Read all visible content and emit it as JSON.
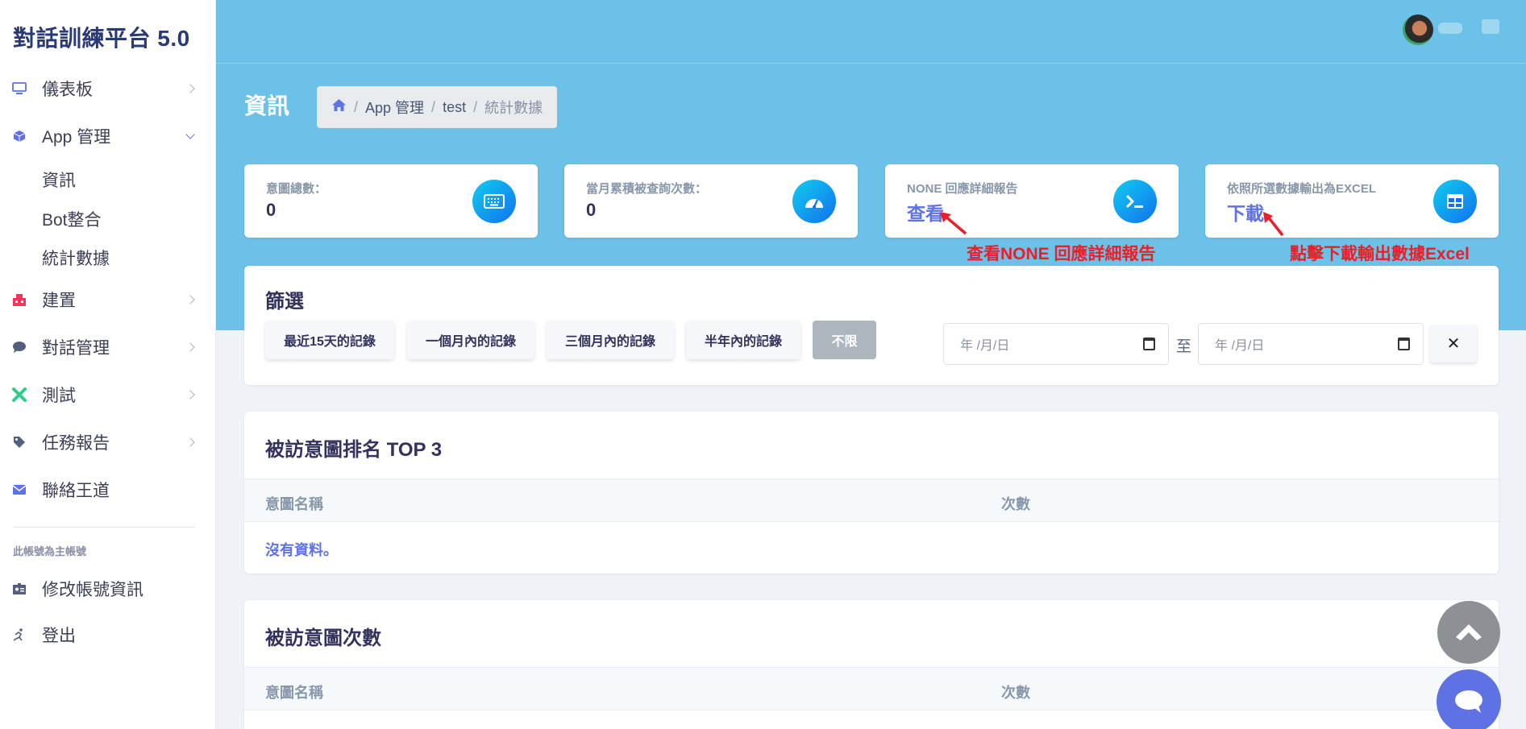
{
  "sidebar": {
    "brand": "對話訓練平台 5.0",
    "items": [
      {
        "label": "儀表板",
        "icon": "monitor-icon"
      },
      {
        "label": "App 管理",
        "icon": "cube-icon"
      },
      {
        "label": "建置",
        "icon": "build-icon"
      },
      {
        "label": "對話管理",
        "icon": "chat-bubble-icon"
      },
      {
        "label": "測試",
        "icon": "tools-icon"
      },
      {
        "label": "任務報告",
        "icon": "tag-icon"
      },
      {
        "label": "聯絡王道",
        "icon": "envelope-icon"
      }
    ],
    "sub_items": [
      "資訊",
      "Bot整合",
      "統計數據"
    ],
    "account_note": "此帳號為主帳號",
    "account_items": [
      {
        "label": "修改帳號資訊",
        "icon": "id-badge-icon"
      },
      {
        "label": "登出",
        "icon": "running-icon"
      }
    ]
  },
  "header": {
    "page_title": "資訊",
    "breadcrumb": [
      "App 管理",
      "test",
      "統計數據"
    ]
  },
  "stats": [
    {
      "title": "意圖總數：",
      "value": "0",
      "icon": "keyboard-icon"
    },
    {
      "title": "當月累積被查詢次數：",
      "value": "0",
      "icon": "speedometer-icon"
    },
    {
      "title": "NONE 回應詳細報告",
      "link": "查看",
      "icon": "terminal-icon"
    },
    {
      "title": "依照所選數據輸出為EXCEL",
      "link": "下載",
      "icon": "table-icon"
    }
  ],
  "annotations": {
    "view_note": "查看NONE 回應詳細報告",
    "download_note": "點擊下載輸出數據Excel",
    "color": "#e8202a"
  },
  "filter": {
    "title": "篩選",
    "buttons": [
      "最近15天的記錄",
      "一個月內的記錄",
      "三個月內的記錄",
      "半年內的記錄",
      "不限"
    ],
    "active": "不限",
    "date_placeholder": "年 /月/日",
    "to_label": "至",
    "clear": "✕"
  },
  "top3": {
    "title": "被訪意圖排名 TOP 3",
    "columns": [
      "意圖名稱",
      "次數"
    ],
    "empty": "沒有資料。"
  },
  "counts": {
    "title": "被訪意圖次數",
    "columns": [
      "意圖名稱",
      "次數"
    ]
  },
  "colors": {
    "header_band": "#6cc1e8",
    "accent": "#5e72e4",
    "brand": "#2a3a78"
  }
}
